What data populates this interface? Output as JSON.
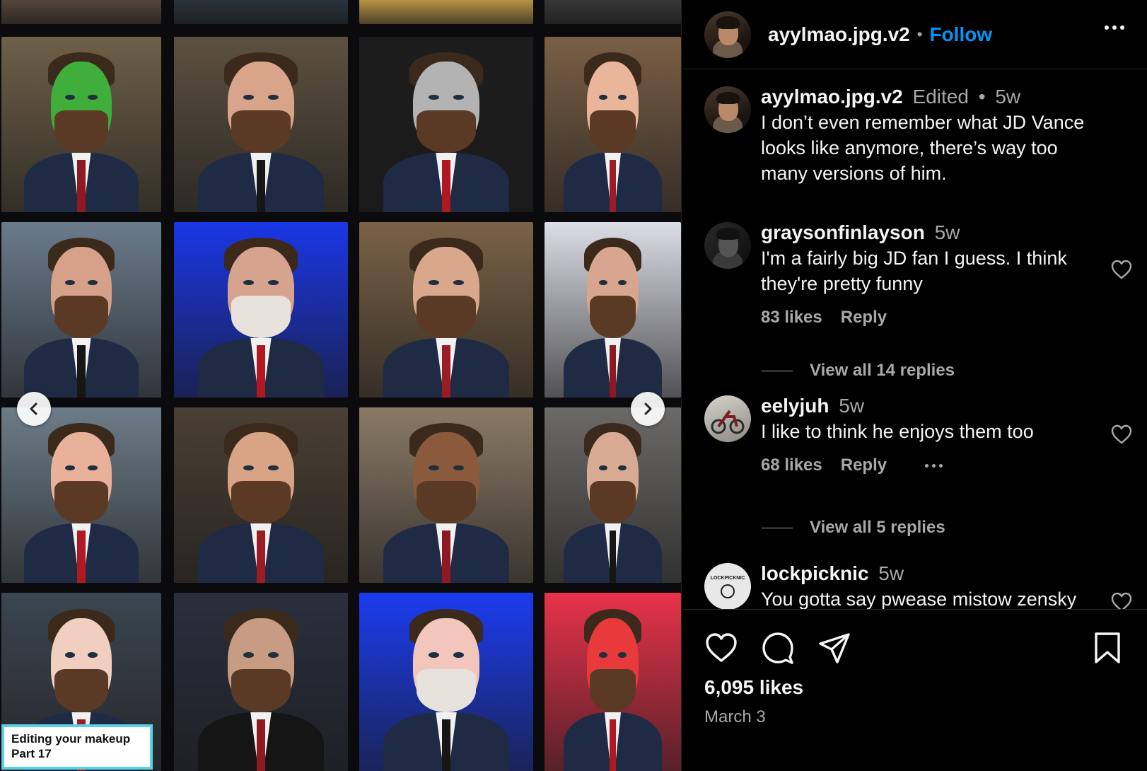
{
  "post": {
    "caption_overlay": [
      "Editing your makeup",
      "Part 17"
    ]
  },
  "author": {
    "username": "ayylmao.jpg.v2",
    "follow_label": "Follow"
  },
  "comments": [
    {
      "username": "ayylmao.jpg.v2",
      "edited": "Edited",
      "separator": "•",
      "age": "5w",
      "text": "I don’t even remember what JD Vance looks like anymore, there’s way too many versions of him."
    },
    {
      "username": "graysonfinlayson",
      "age": "5w",
      "text": "I'm a fairly big JD fan I guess. I think they're pretty funny",
      "likes": "83 likes",
      "reply_label": "Reply",
      "view_replies": "View all 14 replies"
    },
    {
      "username": "eelyjuh",
      "age": "5w",
      "text": "I like to think he enjoys them too",
      "likes": "68 likes",
      "reply_label": "Reply",
      "view_replies": "View all 5 replies"
    },
    {
      "username": "lockpicknic",
      "age": "5w",
      "text": "You gotta say pwease mistow zensky",
      "avatar_text": "LOCKPICKNIC"
    }
  ],
  "footer": {
    "likes": "6,095 likes",
    "date": "March 3"
  },
  "icons": [
    "heart-icon",
    "comment-icon",
    "share-icon",
    "bookmark-icon",
    "chevron-left-icon",
    "chevron-right-icon",
    "more-icon"
  ],
  "colors": {
    "accent": "#0095f6",
    "background": "#000000",
    "secondary_text": "#a8a8a8",
    "primary_text": "#f5f5f5"
  }
}
